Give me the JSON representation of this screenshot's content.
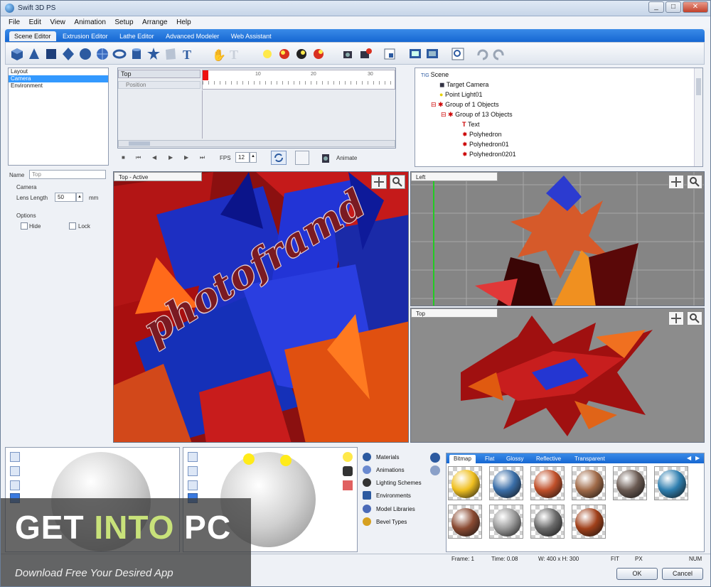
{
  "window": {
    "title": "Swift 3D PS",
    "controls": [
      "_",
      "□",
      "✕"
    ]
  },
  "menu": [
    "File",
    "Edit",
    "View",
    "Animation",
    "Setup",
    "Arrange",
    "Help"
  ],
  "tabs": [
    "Scene Editor",
    "Extrusion Editor",
    "Lathe Editor",
    "Advanced Modeler",
    "Web Assistant"
  ],
  "left_panel": {
    "list": [
      "Layout",
      "Camera",
      "Environment"
    ],
    "name_label": "Name",
    "name_value": "Top",
    "camera_label": "Camera",
    "lens_label": "Lens Length",
    "lens_value": "50",
    "lens_unit": "mm",
    "options_label": "Options",
    "hide_label": "Hide",
    "lock_label": "Lock"
  },
  "timeline": {
    "track": "Top",
    "subtrack": "Position",
    "ticks": [
      "10",
      "20",
      "30"
    ],
    "fps_label": "FPS",
    "fps_value": "12",
    "animate_label": "Animate"
  },
  "tree": [
    "Scene",
    "Target Camera",
    "Point Light01",
    "Group of 1 Objects",
    "Group of 13 Objects",
    "Text",
    "Polyhedron",
    "Polyhedron01",
    "Polyhedron0201"
  ],
  "viewports": {
    "main_label": "Top - Active",
    "main_text": "photoframd",
    "left_label": "Left",
    "top_label": "Top"
  },
  "library_nav": [
    "Materials",
    "Animations",
    "Lighting Schemes",
    "Environments",
    "Model Libraries",
    "Bevel Types"
  ],
  "material_tabs": [
    "Bitmap",
    "Flat",
    "Glossy",
    "Reflective",
    "Transparent"
  ],
  "materials": [
    "#f0c020",
    "#3a6ea8",
    "#c0502a",
    "#a06a48",
    "#6a5a52",
    "#2f7fb0",
    "#8a4a32",
    "#9a9a9a",
    "#6a6a6a",
    "#a0401a"
  ],
  "status": {
    "frame": "Frame: 1",
    "time": "Time: 0.08",
    "size": "W: 400 x H: 300",
    "fit": "FIT",
    "px": "PX",
    "num": "NUM"
  },
  "buttons": {
    "ok": "OK",
    "cancel": "Cancel"
  },
  "watermark": {
    "part1": "GET ",
    "part2": "INTO",
    "part3": " PC",
    "tagline": "Download Free Your Desired App"
  }
}
